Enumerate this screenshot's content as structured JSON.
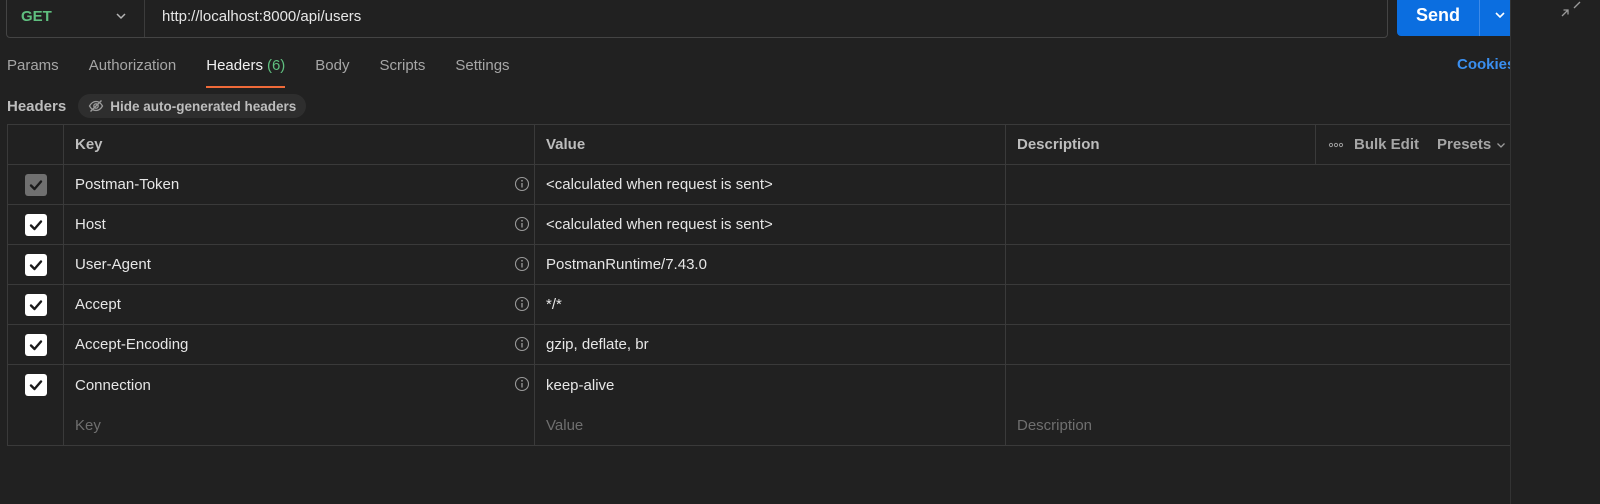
{
  "request": {
    "method": "GET",
    "url": "http://localhost:8000/api/users",
    "send_label": "Send"
  },
  "tabs": [
    {
      "label": "Params",
      "active": false
    },
    {
      "label": "Authorization",
      "active": false
    },
    {
      "label": "Headers",
      "count": "(6)",
      "active": true
    },
    {
      "label": "Body",
      "active": false
    },
    {
      "label": "Scripts",
      "active": false
    },
    {
      "label": "Settings",
      "active": false
    }
  ],
  "cookies_label": "Cookies",
  "subbar": {
    "title": "Headers",
    "hide_label": "Hide auto-generated headers"
  },
  "table": {
    "columns": {
      "key": "Key",
      "value": "Value",
      "description": "Description"
    },
    "bulk_edit": "Bulk Edit",
    "presets": "Presets",
    "rows": [
      {
        "key": "Postman-Token",
        "value": "<calculated when request is sent>",
        "checked": true,
        "disabled": true
      },
      {
        "key": "Host",
        "value": "<calculated when request is sent>",
        "checked": true,
        "disabled": false
      },
      {
        "key": "User-Agent",
        "value": "PostmanRuntime/7.43.0",
        "checked": true,
        "disabled": false
      },
      {
        "key": "Accept",
        "value": "*/*",
        "checked": true,
        "disabled": false
      },
      {
        "key": "Accept-Encoding",
        "value": "gzip, deflate, br",
        "checked": true,
        "disabled": false
      },
      {
        "key": "Connection",
        "value": "keep-alive",
        "checked": true,
        "disabled": false
      }
    ],
    "placeholders": {
      "key": "Key",
      "value": "Value",
      "description": "Description"
    }
  },
  "colors": {
    "background": "#212121",
    "accent_send": "#0b6ee0",
    "method_get": "#5fbf7f",
    "active_tab_underline": "#ef6a39",
    "link": "#3a8ff0"
  }
}
